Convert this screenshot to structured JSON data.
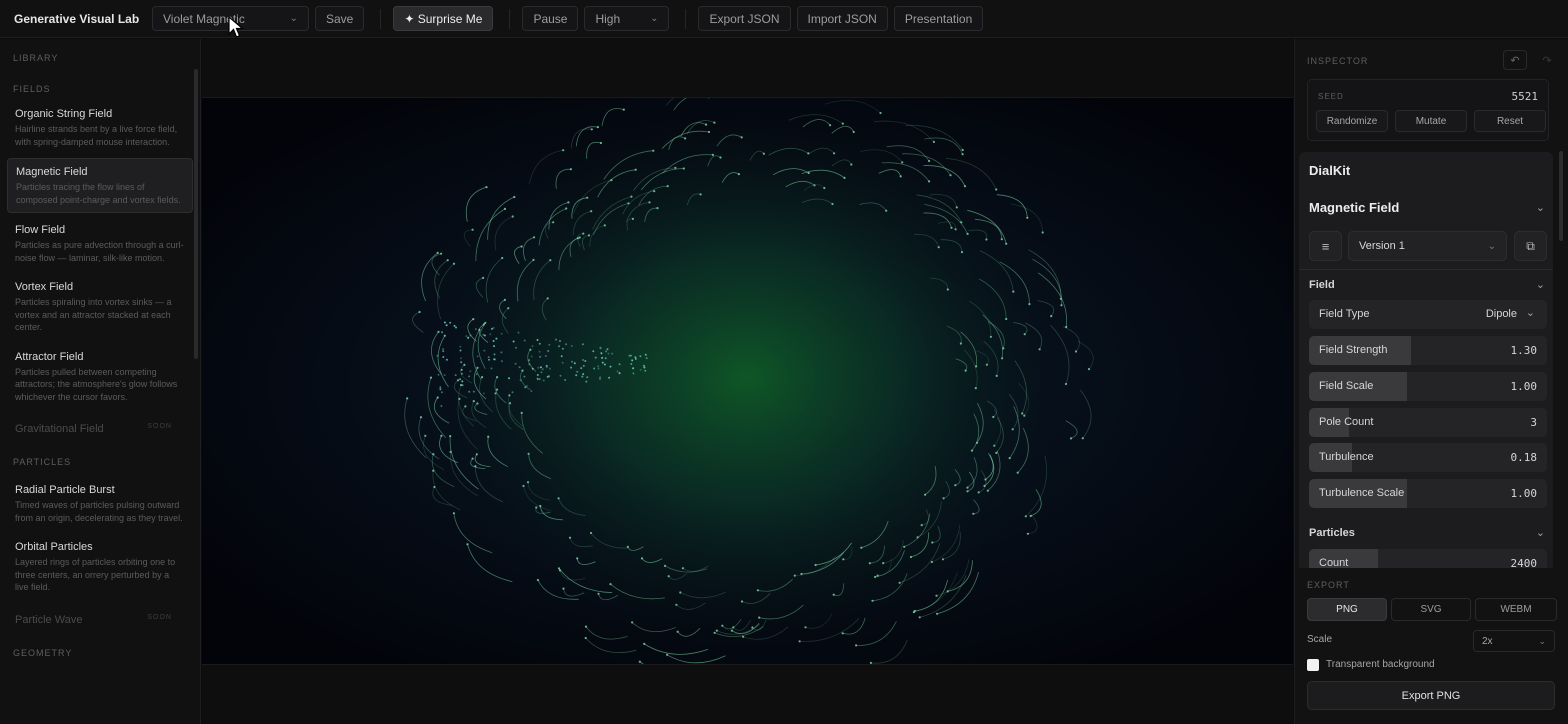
{
  "topbar": {
    "app_title": "Generative Visual Lab",
    "preset_select": "Violet Magnetic",
    "save": "Save",
    "surprise": "✦ Surprise Me",
    "pause": "Pause",
    "quality_select": "High",
    "export_json": "Export JSON",
    "import_json": "Import JSON",
    "presentation": "Presentation"
  },
  "sidebar": {
    "library": "LIBRARY",
    "fields_title": "FIELDS",
    "fields": [
      {
        "title": "Organic String Field",
        "desc": "Hairline strands bent by a live force field, with spring-damped mouse interaction."
      },
      {
        "title": "Magnetic Field",
        "desc": "Particles tracing the flow lines of composed point-charge and vortex fields."
      },
      {
        "title": "Flow Field",
        "desc": "Particles as pure advection through a curl-noise flow — laminar, silk-like motion."
      },
      {
        "title": "Vortex Field",
        "desc": "Particles spiraling into vortex sinks — a vortex and an attractor stacked at each center."
      },
      {
        "title": "Attractor Field",
        "desc": "Particles pulled between competing attractors; the atmosphere's glow follows whichever the cursor favors."
      }
    ],
    "gravitational": "Gravitational Field",
    "soon": "SOON",
    "particles_title": "PARTICLES",
    "particles": [
      {
        "title": "Radial Particle Burst",
        "desc": "Timed waves of particles pulsing outward from an origin, decelerating as they travel."
      },
      {
        "title": "Orbital Particles",
        "desc": "Layered rings of particles orbiting one to three centers, an orrery perturbed by a live field."
      }
    ],
    "particle_wave": "Particle Wave",
    "geometry_title": "GEOMETRY"
  },
  "inspector": {
    "title": "INSPECTOR",
    "seed_label": "SEED",
    "seed_value": "5521",
    "randomize": "Randomize",
    "mutate": "Mutate",
    "reset": "Reset",
    "dialkit": "DialKit",
    "panel_title": "Magnetic Field",
    "version": "Version 1",
    "field_section": "Field",
    "field_type_label": "Field Type",
    "field_type_value": "Dipole",
    "particles_section": "Particles",
    "sliders": [
      {
        "label": "Field Strength",
        "value": "1.30",
        "fill": 0.43
      },
      {
        "label": "Field Scale",
        "value": "1.00",
        "fill": 0.41
      },
      {
        "label": "Pole Count",
        "value": "3",
        "fill": 0.17
      },
      {
        "label": "Turbulence",
        "value": "0.18",
        "fill": 0.18
      },
      {
        "label": "Turbulence Scale",
        "value": "1.00",
        "fill": 0.41
      },
      {
        "label": "Count",
        "value": "2400",
        "fill": 0.29
      }
    ]
  },
  "export": {
    "title": "EXPORT",
    "formats": [
      "PNG",
      "SVG",
      "WEBM"
    ],
    "selected_format": "PNG",
    "scale_label": "Scale",
    "scale_value": "2x",
    "transparent": "Transparent background",
    "export_button": "Export PNG"
  },
  "colors": {
    "accent_green": "#1c7a3a",
    "particle": "#7fd9a8"
  }
}
